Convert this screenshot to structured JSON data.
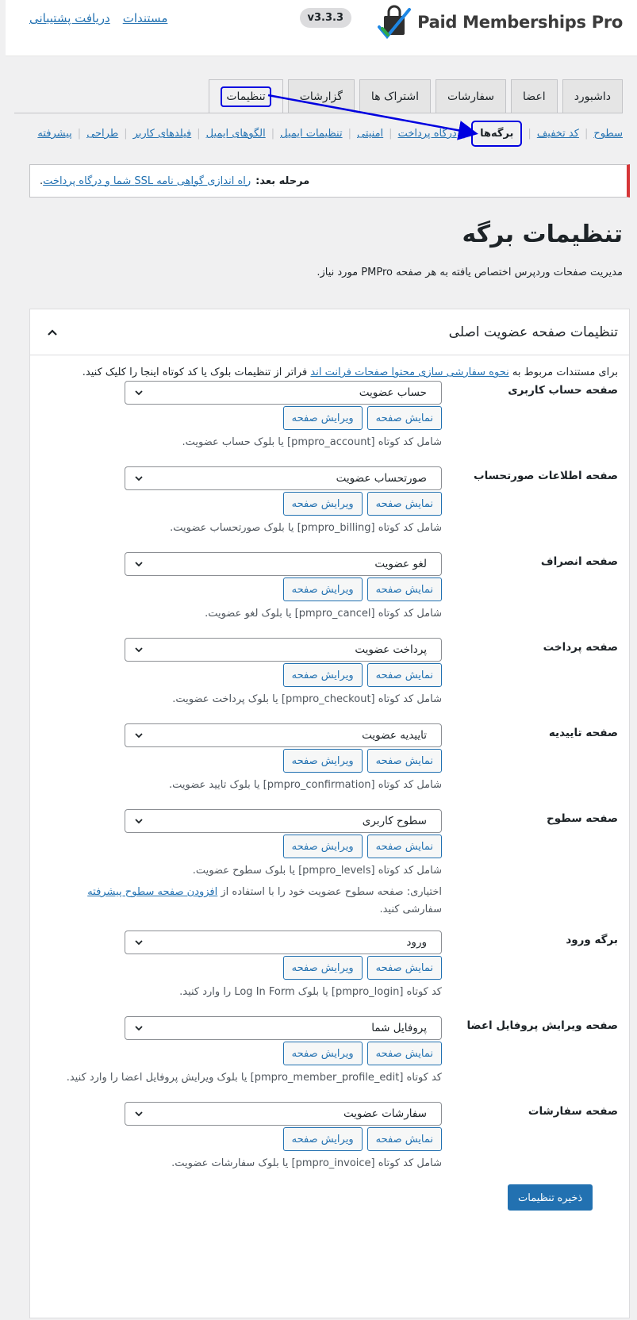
{
  "header": {
    "brand_name": "Paid Memberships Pro",
    "version": "v3.3.3",
    "links": [
      "مستندات",
      "دریافت پشتیبانی"
    ]
  },
  "nav_tabs": [
    {
      "label": "داشبورد",
      "active": false
    },
    {
      "label": "اعضا",
      "active": false
    },
    {
      "label": "سفارشات",
      "active": false
    },
    {
      "label": "اشتراک ها",
      "active": false
    },
    {
      "label": "گزارشات",
      "active": false
    },
    {
      "label": "تنظیمات",
      "active": true
    }
  ],
  "sub_nav": [
    {
      "label": "سطوح",
      "current": false
    },
    {
      "label": "کد تخفیف",
      "current": false
    },
    {
      "label": "برگه‌ها",
      "current": true
    },
    {
      "label": "درگاه پرداخت",
      "current": false
    },
    {
      "label": "امنیتی",
      "current": false
    },
    {
      "label": "تنظیمات ایمیل",
      "current": false
    },
    {
      "label": "الگوهای ایمیل",
      "current": false
    },
    {
      "label": "فیلدهای کاربر",
      "current": false
    },
    {
      "label": "طراحی",
      "current": false
    },
    {
      "label": "پیشرفته",
      "current": false
    }
  ],
  "notice": {
    "label": "مرحله بعد:",
    "link": "راه اندازی گواهی نامه SSL شما و درگاه پرداخت",
    "suffix": "."
  },
  "page": {
    "title": "تنظیمات برگه",
    "description": "مدیریت صفحات وردپرس اختصاص یافته به هر صفحه PMPro مورد نیاز."
  },
  "panel": {
    "title": "تنظیمات صفحه عضویت اصلی",
    "intro_prefix": "برای مستندات مربوط به",
    "intro_link": "نحوه سفارشی سازی محتوا صفحات فرانت اند",
    "intro_suffix": "فراتر از تنظیمات بلوک یا کد کوتاه اینجا را کلیک کنید."
  },
  "buttons": {
    "edit": "ویرایش صفحه",
    "view": "نمایش صفحه",
    "save": "ذخیره تنظیمات"
  },
  "rows": [
    {
      "label": "صفحه حساب کاربری",
      "value": "حساب عضویت",
      "hint": "شامل کد کوتاه [pmpro_account] یا بلوک حساب عضویت."
    },
    {
      "label": "صفحه اطلاعات صورتحساب",
      "value": "صورتحساب عضویت",
      "hint": "شامل کد کوتاه [pmpro_billing] یا بلوک صورتحساب عضویت."
    },
    {
      "label": "صفحه انصراف",
      "value": "لغو عضویت",
      "hint": "شامل کد کوتاه [pmpro_cancel] یا بلوک لغو عضویت."
    },
    {
      "label": "صفحه پرداخت",
      "value": "پرداخت عضویت",
      "hint": "شامل کد کوتاه [pmpro_checkout] یا بلوک پرداخت عضویت."
    },
    {
      "label": "صفحه تاییدیه",
      "value": "تاییدیه عضویت",
      "hint": "شامل کد کوتاه [pmpro_confirmation] یا بلوک تایید عضویت."
    },
    {
      "label": "صفحه سطوح",
      "value": "سطوح کاربری",
      "hint": "شامل کد کوتاه [pmpro_levels] یا بلوک سطوح عضویت.",
      "extra_prefix": "اختیاری: صفحه سطوح عضویت خود را با استفاده از",
      "extra_link": "افزودن صفحه سطوح پیشرفته",
      "extra_suffix": "سفارشی کنید."
    },
    {
      "label": "برگه ورود",
      "value": "ورود",
      "hint": "کد کوتاه [pmpro_login] یا بلوک Log In Form را وارد کنید."
    },
    {
      "label": "صفحه ویرایش پروفایل اعضا",
      "value": "پروفایل شما",
      "hint": "کد کوتاه [pmpro_member_profile_edit] یا بلوک ویرایش پروفایل اعضا را وارد کنید."
    },
    {
      "label": "صفحه سفارشات",
      "value": "سفارشات عضویت",
      "hint": "شامل کد کوتاه [pmpro_invoice] یا بلوک سفارشات عضویت."
    }
  ],
  "colors": {
    "link": "#2271b1",
    "primary_button": "#2271b1",
    "notice_border": "#d63638",
    "annotation": "#0000e0"
  }
}
